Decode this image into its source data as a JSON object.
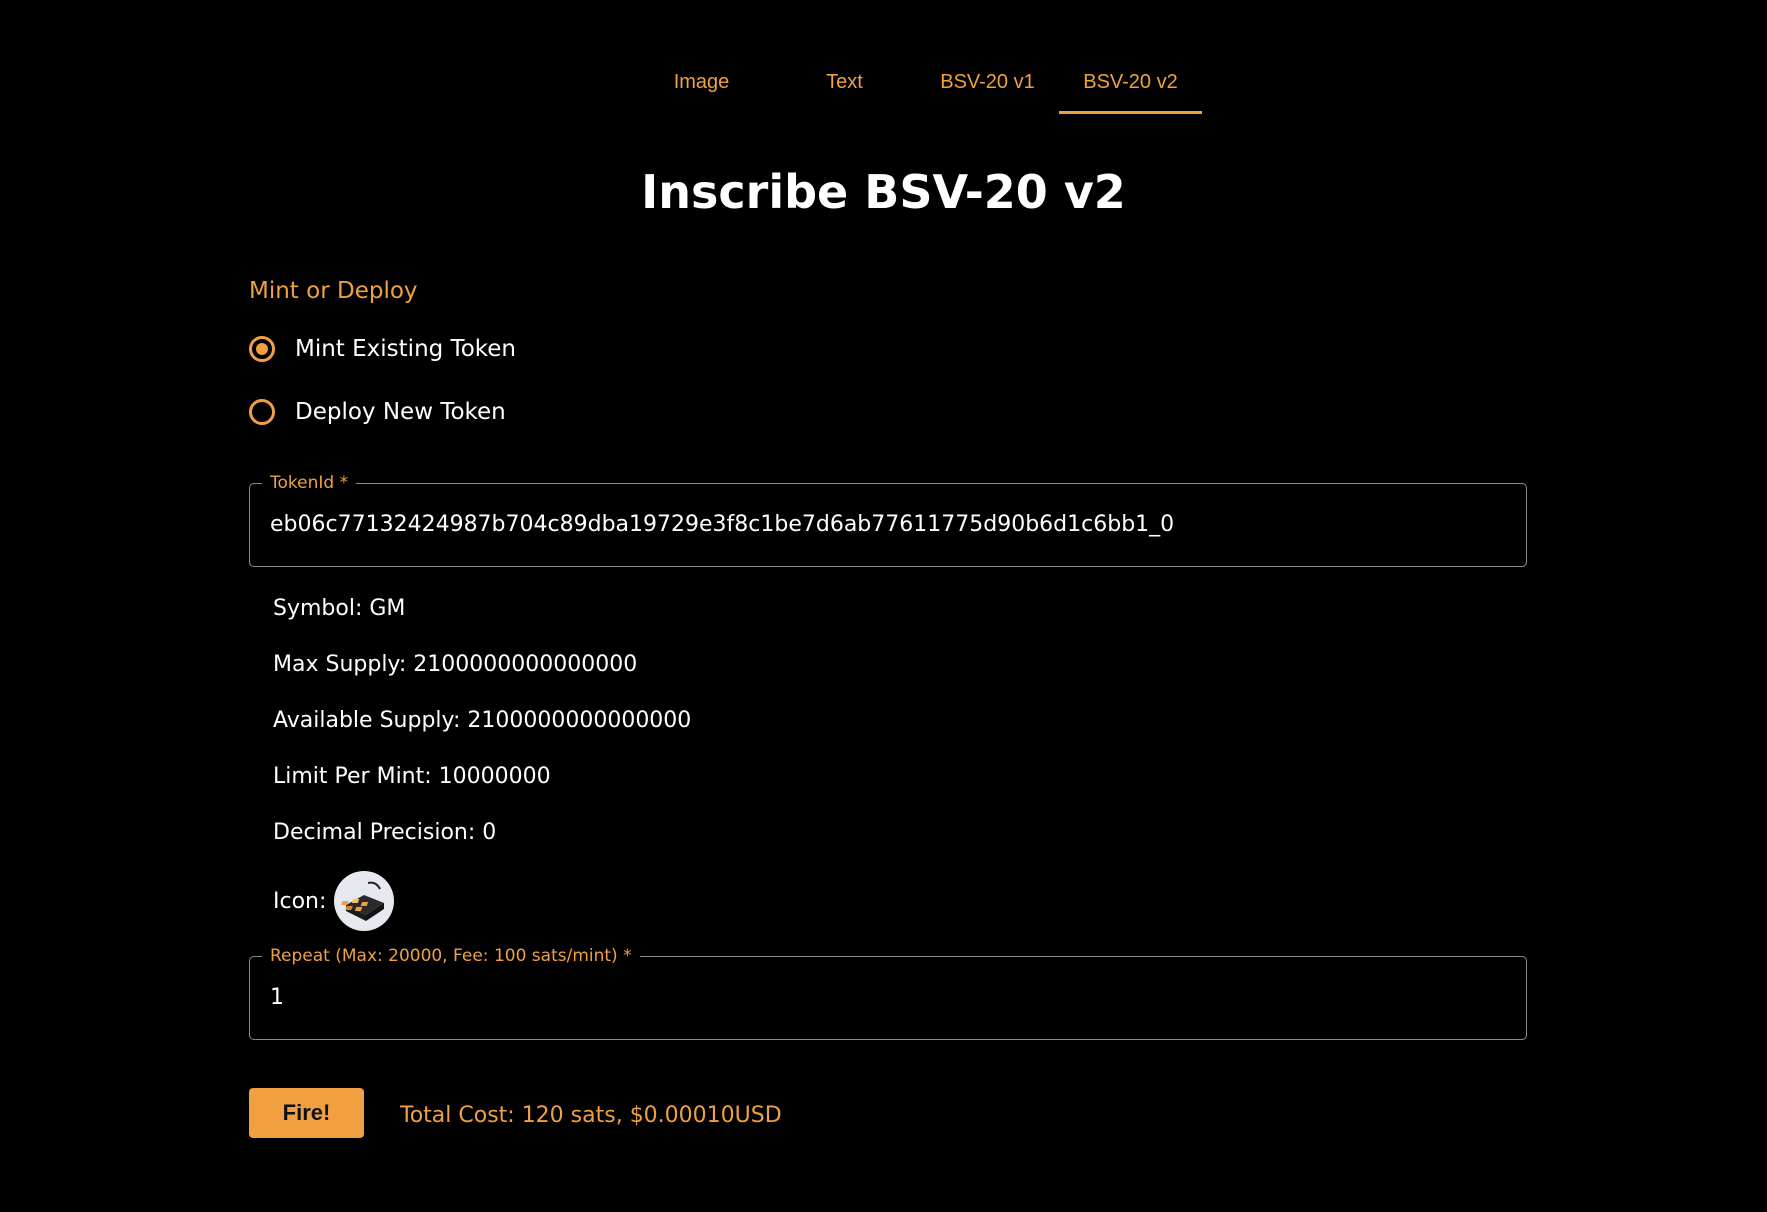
{
  "tabs": [
    {
      "label": "Image",
      "active": false
    },
    {
      "label": "Text",
      "active": false
    },
    {
      "label": "BSV-20 v1",
      "active": false
    },
    {
      "label": "BSV-20 v2",
      "active": true
    }
  ],
  "title": "Inscribe BSV-20 v2",
  "mode": {
    "label": "Mint or Deploy",
    "options": [
      {
        "label": "Mint Existing Token",
        "checked": true
      },
      {
        "label": "Deploy New Token",
        "checked": false
      }
    ]
  },
  "token_id": {
    "legend": "TokenId *",
    "value": "eb06c77132424987b704c89dba19729e3f8c1be7d6ab77611775d90b6d1c6bb1_0"
  },
  "token_info": {
    "symbol": "Symbol: GM",
    "max_supply": "Max Supply: 2100000000000000",
    "available_supply": "Available Supply: 2100000000000000",
    "limit_per_mint": "Limit Per Mint: 10000000",
    "decimal_precision": "Decimal Precision: 0",
    "icon_label": "Icon:",
    "icon_name": "token-logo-icon"
  },
  "repeat": {
    "legend": "Repeat (Max: 20000, Fee: 100 sats/mint) *",
    "value": "1"
  },
  "fire_button": "Fire!",
  "total_cost": "Total Cost: 120 sats, $0.00010USD",
  "colors": {
    "accent": "#f0a040",
    "background": "#000000",
    "text": "#ffffff",
    "border": "#8a8a8a"
  }
}
